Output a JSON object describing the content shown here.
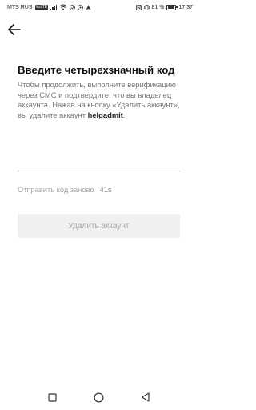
{
  "status_bar": {
    "carrier": "MTS RUS",
    "network_badge": "VoLTE",
    "battery_percent": "81 %",
    "time": "17:37",
    "icons": [
      "signal-icon",
      "wifi-icon",
      "nfc-icon",
      "vibrate-icon",
      "battery-icon"
    ]
  },
  "header": {
    "back_icon": "arrow-left-icon"
  },
  "verify": {
    "title": "Введите четырехзначный код",
    "description": "Чтобы продолжить, выполните верификацию через СМС и подтвердите, что вы владелец аккаунта. Нажав на кнопку «Удалить аккаунт», вы удалите аккаунт",
    "account_name": "helgadmit",
    "description_end": ".",
    "code_value": "",
    "resend_label": "Отправить код заново",
    "resend_timer": "41s",
    "delete_button_label": "Удалить аккаунт"
  },
  "nav_bar": {
    "icons": [
      "recents-square-icon",
      "home-circle-icon",
      "back-triangle-icon"
    ]
  }
}
